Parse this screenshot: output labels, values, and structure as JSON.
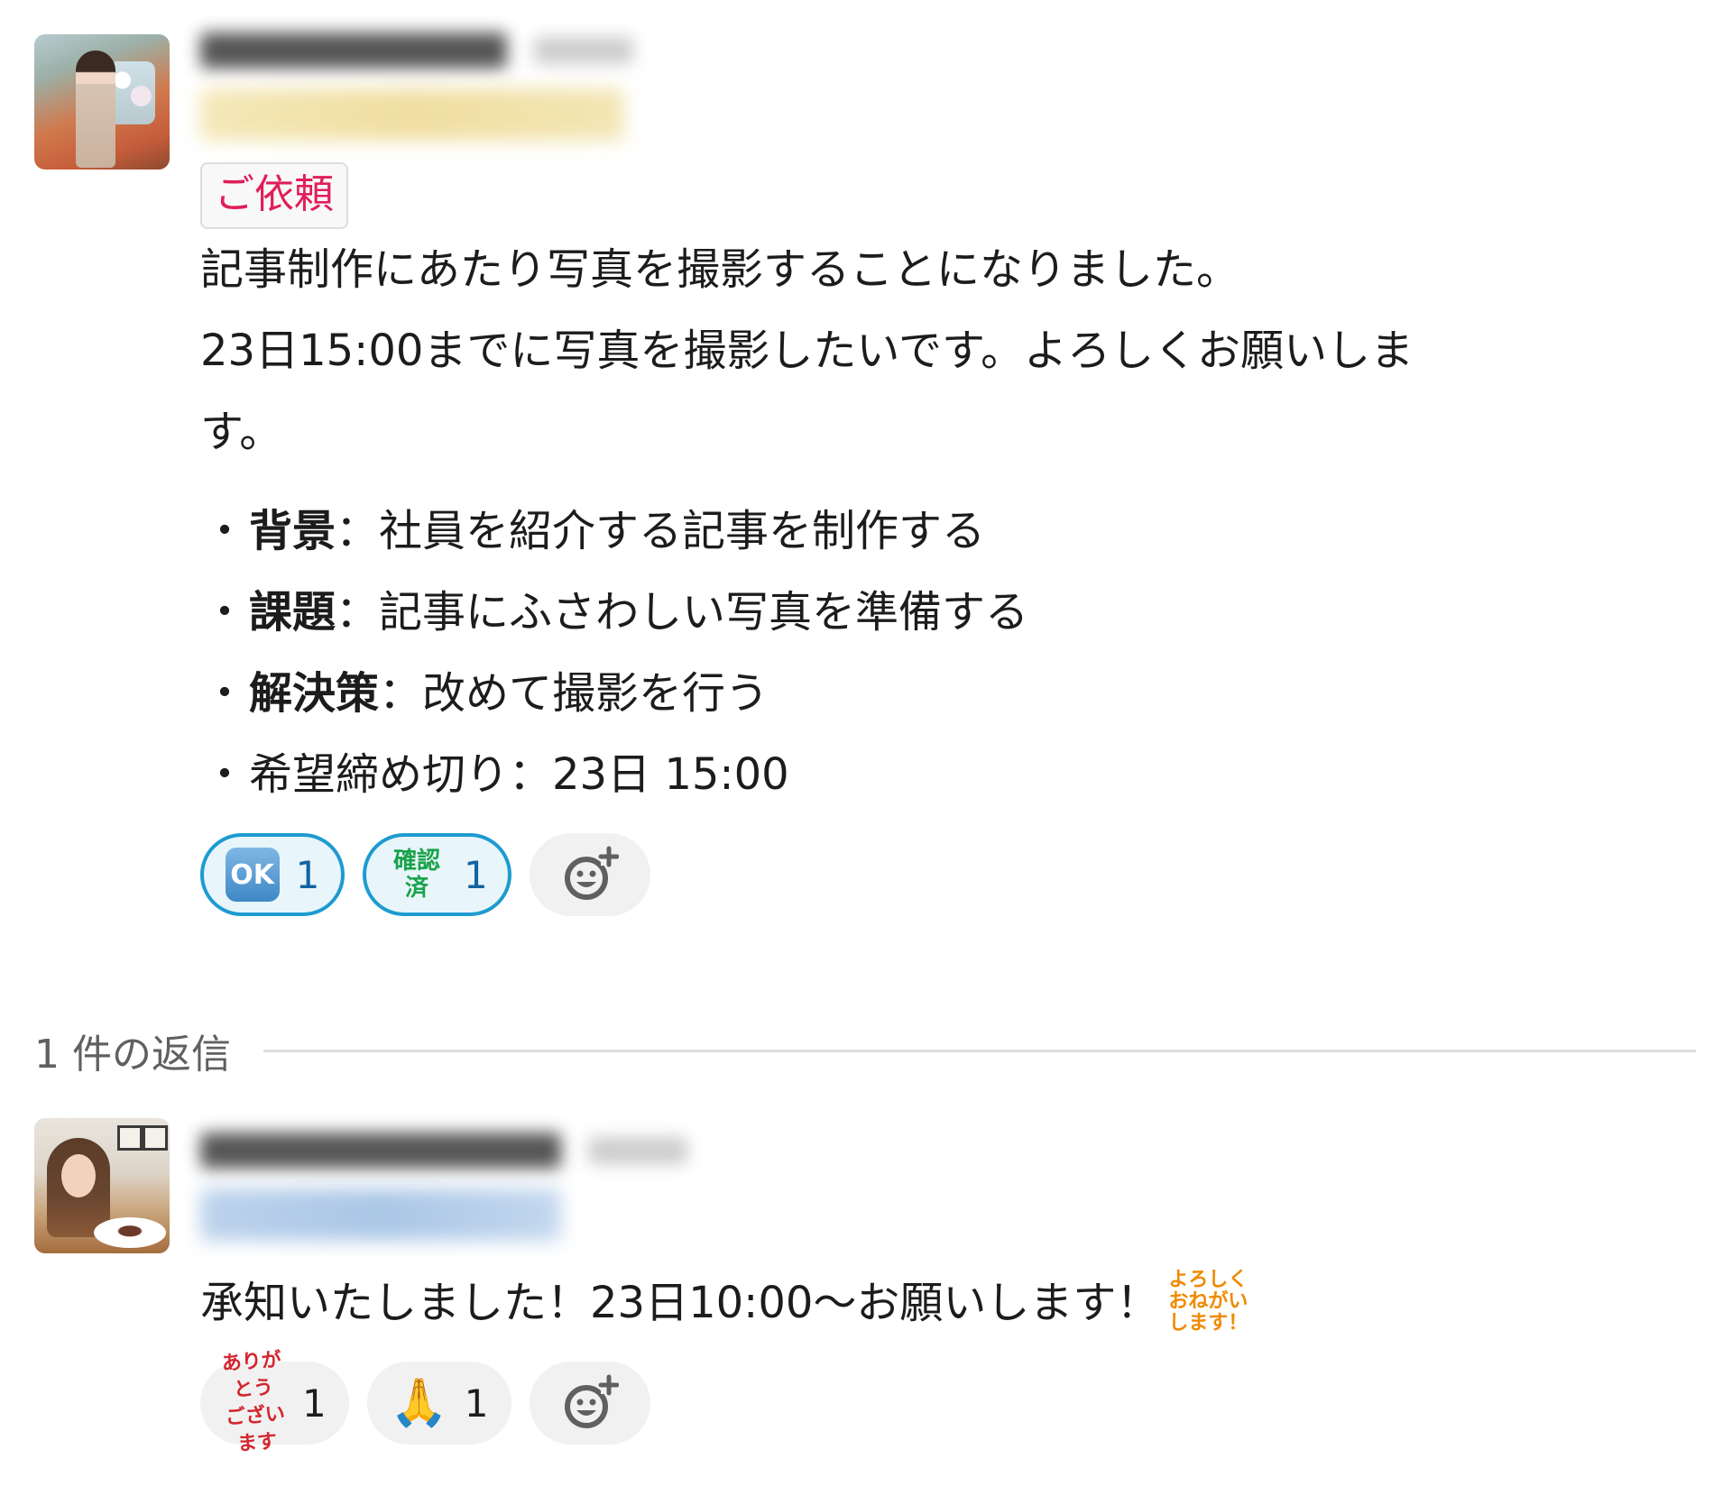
{
  "message1": {
    "tag": "ご依頼",
    "body_lines": [
      "記事制作にあたり写真を撮影することになりました。",
      "23日15:00までに写真を撮影したいです。よろしくお願いしま",
      "す。"
    ],
    "bullets": [
      {
        "bullet": "・",
        "bold": "背景",
        "text": "：社員を紹介する記事を制作する"
      },
      {
        "bullet": "・",
        "bold": "課題",
        "text": "：記事にふさわしい写真を準備する"
      },
      {
        "bullet": "・",
        "bold": "解決策",
        "text": "：改めて撮影を行う"
      },
      {
        "bullet": "・",
        "bold": "",
        "text": "希望締め切り：23日 15:00"
      }
    ],
    "reactions": [
      {
        "emoji_name": "ok-emoji",
        "emoji_text": "OK",
        "count": "1",
        "active": true
      },
      {
        "emoji_name": "kakunin-zumi-emoji",
        "emoji_text_line1": "確認",
        "emoji_text_line2": "済",
        "count": "1",
        "active": true
      }
    ]
  },
  "thread": {
    "replies_label": "1 件の返信"
  },
  "message2": {
    "body": "承知いたしました！23日10:00〜お願いします！",
    "inline_emoji": {
      "name": "yoroshiku-onegaishimasu-emoji",
      "line1": "よろしく",
      "line2": "おねがい",
      "line3": "します！"
    },
    "reactions": [
      {
        "emoji_name": "arigatou-gozaimasu-emoji",
        "emoji_line1": "ありがとう",
        "emoji_line2": "ございます",
        "count": "1"
      },
      {
        "emoji_name": "pray-emoji",
        "emoji_text": "🙏",
        "count": "1"
      }
    ]
  },
  "icons": {
    "add_reaction": "add-reaction-icon"
  },
  "colors": {
    "tag_text": "#e01e5a",
    "reaction_active_border": "#1d9bd1",
    "reaction_active_count": "#1264a3",
    "kakunin_green": "#1aa34a",
    "arigato_red": "#d3262e",
    "yoroshiku_orange": "#f08a00"
  }
}
